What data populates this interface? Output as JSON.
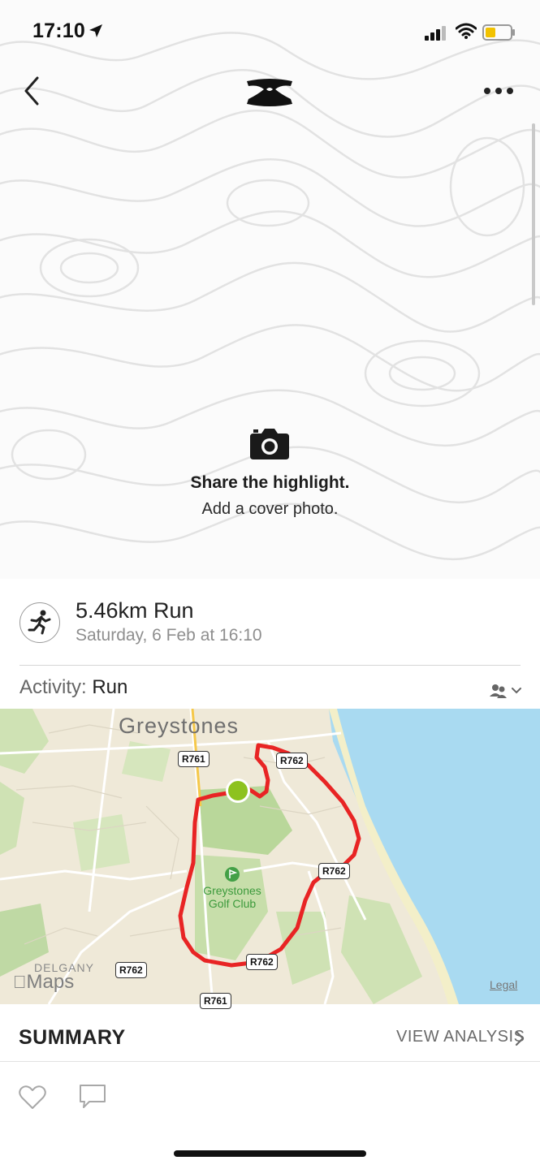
{
  "status_bar": {
    "time": "17:10"
  },
  "cover": {
    "title": "Share the highlight.",
    "subtitle": "Add a cover photo."
  },
  "activity": {
    "title": "5.46km Run",
    "date": "Saturday, 6 Feb at 16:10",
    "type_label": "Activity: ",
    "type_value": "Run"
  },
  "map": {
    "town": "Greystones",
    "golf_club": "Greystones Golf Club",
    "area": "DELGANY",
    "roads": [
      "R761",
      "R762",
      "R762",
      "R762",
      "R762",
      "R761"
    ],
    "provider": "Maps",
    "legal": "Legal",
    "route_color": "#e82424",
    "start_marker_color": "#8dc21f",
    "sea_color": "#a9daf1"
  },
  "summary": {
    "title": "SUMMARY",
    "view_analysis": "VIEW ANALYSIS"
  }
}
